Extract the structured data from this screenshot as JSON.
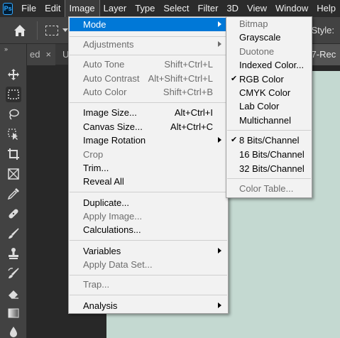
{
  "app": {
    "logo": "Ps"
  },
  "menubar": {
    "items": [
      "File",
      "Edit",
      "Image",
      "Layer",
      "Type",
      "Select",
      "Filter",
      "3D",
      "View",
      "Window",
      "Help"
    ],
    "active": "Image"
  },
  "options": {
    "style_label": "Style:"
  },
  "tabs": {
    "left_label": "ed",
    "close_glyph": "×",
    "middle_label": "U",
    "right_label": "d-7-Rec"
  },
  "image_menu": {
    "items": [
      {
        "label": "Mode",
        "shortcut": "",
        "submenu": true,
        "disabled": false,
        "highlight": true
      },
      {
        "label": "Adjustments",
        "shortcut": "",
        "submenu": true,
        "disabled": true
      },
      {
        "label": "Auto Tone",
        "shortcut": "Shift+Ctrl+L",
        "disabled": true
      },
      {
        "label": "Auto Contrast",
        "shortcut": "Alt+Shift+Ctrl+L",
        "disabled": true
      },
      {
        "label": "Auto Color",
        "shortcut": "Shift+Ctrl+B",
        "disabled": true
      },
      {
        "label": "Image Size...",
        "shortcut": "Alt+Ctrl+I",
        "disabled": false
      },
      {
        "label": "Canvas Size...",
        "shortcut": "Alt+Ctrl+C",
        "disabled": false
      },
      {
        "label": "Image Rotation",
        "shortcut": "",
        "submenu": true,
        "disabled": false
      },
      {
        "label": "Crop",
        "shortcut": "",
        "disabled": true
      },
      {
        "label": "Trim...",
        "shortcut": "",
        "disabled": false
      },
      {
        "label": "Reveal All",
        "shortcut": "",
        "disabled": false
      },
      {
        "label": "Duplicate...",
        "shortcut": "",
        "disabled": false
      },
      {
        "label": "Apply Image...",
        "shortcut": "",
        "disabled": true
      },
      {
        "label": "Calculations...",
        "shortcut": "",
        "disabled": false
      },
      {
        "label": "Variables",
        "shortcut": "",
        "submenu": true,
        "disabled": false
      },
      {
        "label": "Apply Data Set...",
        "shortcut": "",
        "disabled": true
      },
      {
        "label": "Trap...",
        "shortcut": "",
        "disabled": true
      },
      {
        "label": "Analysis",
        "shortcut": "",
        "submenu": true,
        "disabled": false
      }
    ]
  },
  "mode_submenu": {
    "check_glyph": "✔",
    "items": [
      {
        "label": "Bitmap",
        "disabled": true
      },
      {
        "label": "Grayscale",
        "disabled": false
      },
      {
        "label": "Duotone",
        "disabled": true
      },
      {
        "label": "Indexed Color...",
        "disabled": false
      },
      {
        "label": "RGB Color",
        "disabled": false,
        "checked": true
      },
      {
        "label": "CMYK Color",
        "disabled": false
      },
      {
        "label": "Lab Color",
        "disabled": false
      },
      {
        "label": "Multichannel",
        "disabled": false
      },
      {
        "label": "8 Bits/Channel",
        "disabled": false,
        "checked": true
      },
      {
        "label": "16 Bits/Channel",
        "disabled": false
      },
      {
        "label": "32 Bits/Channel",
        "disabled": false
      },
      {
        "label": "Color Table...",
        "disabled": true
      }
    ]
  },
  "toolbar": {
    "collapse_glyph": "»",
    "tools": [
      "move-tool",
      "rectangular-marquee-tool",
      "lasso-tool",
      "object-selection-tool",
      "crop-tool",
      "frame-tool",
      "eyedropper-tool",
      "healing-brush-tool",
      "brush-tool",
      "clone-stamp-tool",
      "history-brush-tool",
      "eraser-tool",
      "gradient-tool",
      "blur-tool"
    ],
    "selected": "rectangular-marquee-tool"
  },
  "colors": {
    "highlight": "#0078d7",
    "canvas": "#c4d9d1",
    "menubar": "#2b2b2b"
  }
}
